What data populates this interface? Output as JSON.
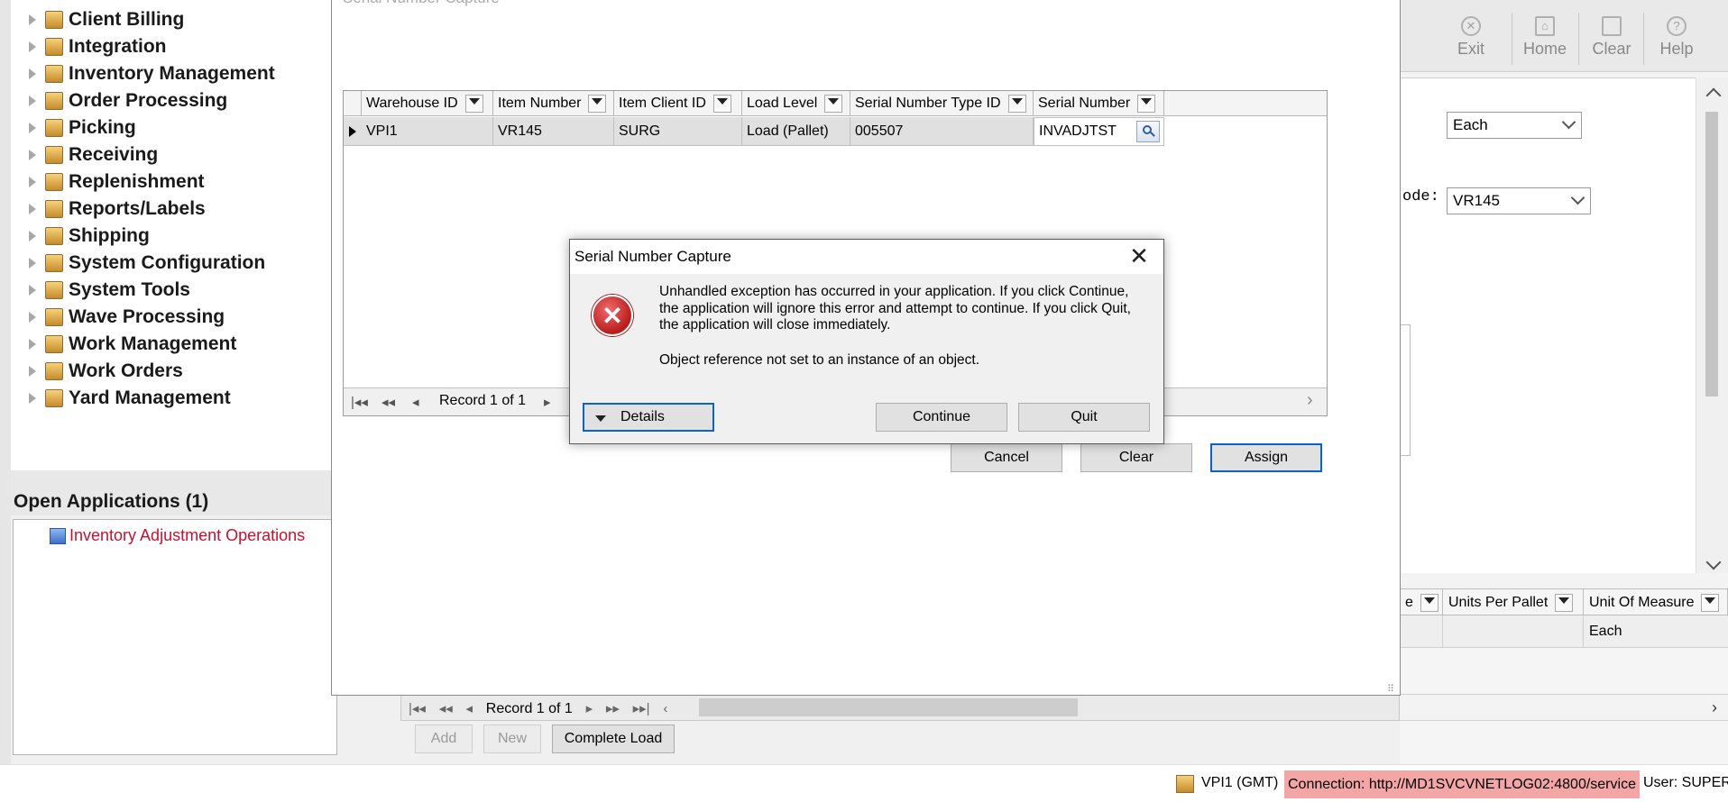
{
  "nav": {
    "items": [
      {
        "label": "Client Billing"
      },
      {
        "label": "Integration"
      },
      {
        "label": "Inventory Management"
      },
      {
        "label": "Order Processing"
      },
      {
        "label": "Picking"
      },
      {
        "label": "Receiving"
      },
      {
        "label": "Replenishment"
      },
      {
        "label": "Reports/Labels"
      },
      {
        "label": "Shipping"
      },
      {
        "label": "System Configuration"
      },
      {
        "label": "System Tools"
      },
      {
        "label": "Wave Processing"
      },
      {
        "label": "Work Management"
      },
      {
        "label": "Work Orders"
      },
      {
        "label": "Yard Management"
      }
    ]
  },
  "open_apps": {
    "title": "Open Applications (1)",
    "items": [
      {
        "label": "Inventory Adjustment Operations",
        "color": "#c8102e"
      }
    ]
  },
  "toolbar": {
    "exit": "Exit",
    "home": "Home",
    "clear": "Clear",
    "help": "Help"
  },
  "bg_form": {
    "uom_value": "Each",
    "code_label": "ode:",
    "code_value": "VR145"
  },
  "bg_grid": {
    "headers": [
      "e",
      "Units Per Pallet",
      "Unit Of Measure"
    ],
    "row": [
      "",
      "",
      "Each"
    ]
  },
  "lower": {
    "record_label": "Record 1 of 1",
    "add": "Add",
    "new": "New",
    "complete_load": "Complete Load"
  },
  "serial_capture": {
    "title": "Serial Number Capture",
    "columns": [
      "Warehouse ID",
      "Item Number",
      "Item Client ID",
      "Load Level",
      "Serial Number Type ID",
      "Serial Number"
    ],
    "row": {
      "warehouse_id": "VPI1",
      "item_number": "VR145",
      "item_client_id": "SURG",
      "load_level": "Load (Pallet)",
      "serial_type_id": "005507",
      "serial_number": "INVADJTST"
    },
    "record_label": "Record 1 of 1",
    "cancel": "Cancel",
    "clear": "Clear",
    "assign": "Assign"
  },
  "dialog": {
    "title": "Serial Number Capture",
    "message": "Unhandled exception has occurred in your application. If you click Continue, the application will ignore this error and attempt to continue. If you click Quit, the application will close immediately.",
    "detail": "Object reference not set to an instance of an object.",
    "details_label": "Details",
    "continue_label": "Continue",
    "quit_label": "Quit"
  },
  "status": {
    "site": "VPI1 (GMT)",
    "connection": "Connection: http://MD1SVCVNETLOG02:4800/service",
    "user": "User: SUPER",
    "connection_bg": "#f4a6a6"
  },
  "colors": {
    "accent": "#0a64c8",
    "error": "#b81c1c"
  }
}
